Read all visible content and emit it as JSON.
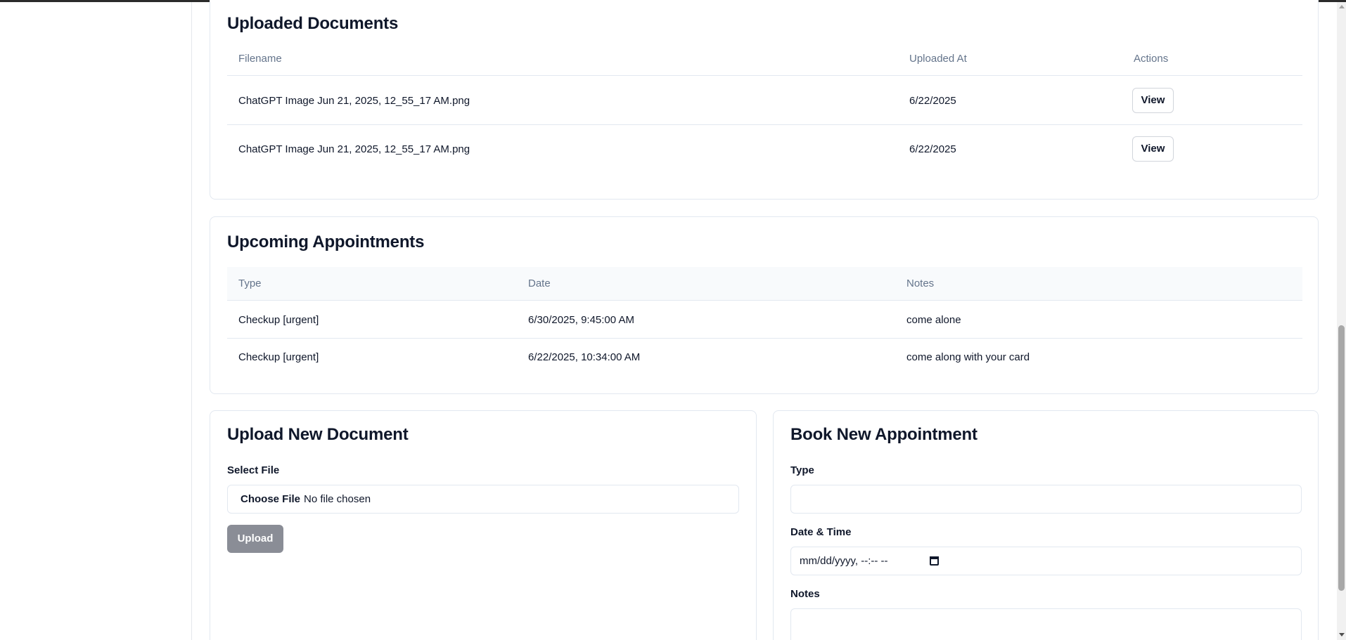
{
  "documents": {
    "title": "Uploaded Documents",
    "columns": [
      "Filename",
      "Uploaded At",
      "Actions"
    ],
    "rows": [
      {
        "filename": "ChatGPT Image Jun 21, 2025, 12_55_17 AM.png",
        "uploaded_at": "6/22/2025",
        "action": "View"
      },
      {
        "filename": "ChatGPT Image Jun 21, 2025, 12_55_17 AM.png",
        "uploaded_at": "6/22/2025",
        "action": "View"
      }
    ]
  },
  "appointments": {
    "title": "Upcoming Appointments",
    "columns": [
      "Type",
      "Date",
      "Notes"
    ],
    "rows": [
      {
        "type": "Checkup [urgent]",
        "date": "6/30/2025, 9:45:00 AM",
        "notes": "come alone"
      },
      {
        "type": "Checkup [urgent]",
        "date": "6/22/2025, 10:34:00 AM",
        "notes": "come along with your card"
      }
    ]
  },
  "upload": {
    "title": "Upload New Document",
    "file_label": "Select File",
    "choose_button": "Choose File",
    "file_status": "No file chosen",
    "upload_button": "Upload"
  },
  "book": {
    "title": "Book New Appointment",
    "type_label": "Type",
    "type_value": "",
    "datetime_label": "Date & Time",
    "datetime_placeholder": "mm/dd/yyyy, --:-- --",
    "notes_label": "Notes",
    "notes_value": ""
  }
}
